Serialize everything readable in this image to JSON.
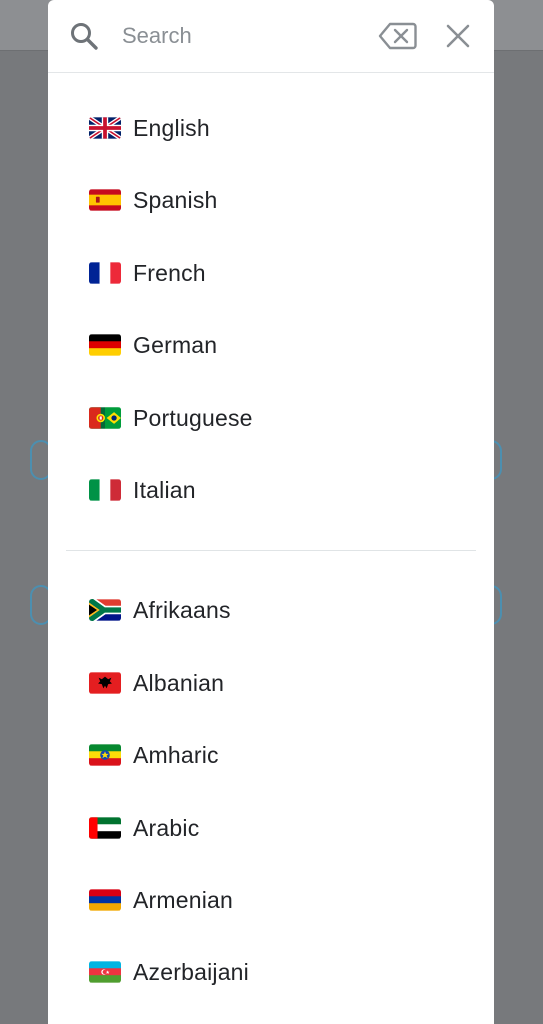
{
  "search": {
    "placeholder": "Search"
  },
  "icons": {
    "search": "search-icon",
    "clear": "backspace-clear-icon",
    "close": "close-icon"
  },
  "colors": {
    "backdrop": "#77797c",
    "dialog": "#ffffff",
    "icon": "#6e7378",
    "text": "#222428",
    "divider": "#e0e4e6"
  },
  "popular_languages": [
    {
      "label": "English",
      "flag": "flag-uk"
    },
    {
      "label": "Spanish",
      "flag": "flag-spain"
    },
    {
      "label": "French",
      "flag": "flag-france"
    },
    {
      "label": "German",
      "flag": "flag-germany"
    },
    {
      "label": "Portuguese",
      "flag": "flag-portugal"
    },
    {
      "label": "Italian",
      "flag": "flag-italy"
    }
  ],
  "all_languages": [
    {
      "label": "Afrikaans",
      "flag": "flag-south-africa"
    },
    {
      "label": "Albanian",
      "flag": "flag-albania"
    },
    {
      "label": "Amharic",
      "flag": "flag-ethiopia"
    },
    {
      "label": "Arabic",
      "flag": "flag-uae"
    },
    {
      "label": "Armenian",
      "flag": "flag-armenia"
    },
    {
      "label": "Azerbaijani",
      "flag": "flag-azerbaijan"
    }
  ]
}
